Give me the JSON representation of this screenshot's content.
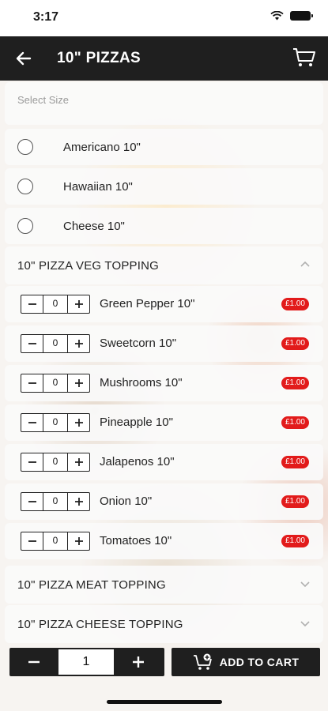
{
  "status_bar": {
    "time": "3:17"
  },
  "app_bar": {
    "title": "10\" PIZZAS"
  },
  "size_section": {
    "placeholder": "Select Size",
    "options": [
      {
        "label": "Americano 10\""
      },
      {
        "label": "Hawaiian 10\""
      },
      {
        "label": "Cheese 10\""
      }
    ]
  },
  "sections": {
    "veg_topping": {
      "title": "10\" PIZZA VEG TOPPING",
      "expanded": true,
      "items": [
        {
          "label": "Green Pepper 10\"",
          "qty": "0",
          "price": "£1.00"
        },
        {
          "label": "Sweetcorn 10\"",
          "qty": "0",
          "price": "£1.00"
        },
        {
          "label": "Mushrooms 10\"",
          "qty": "0",
          "price": "£1.00"
        },
        {
          "label": "Pineapple 10\"",
          "qty": "0",
          "price": "£1.00"
        },
        {
          "label": "Jalapenos 10\"",
          "qty": "0",
          "price": "£1.00"
        },
        {
          "label": "Onion 10\"",
          "qty": "0",
          "price": "£1.00"
        },
        {
          "label": "Tomatoes 10\"",
          "qty": "0",
          "price": "£1.00"
        }
      ]
    },
    "meat_topping": {
      "title": "10\" PIZZA MEAT TOPPING",
      "expanded": false
    },
    "cheese_topping": {
      "title": "10\" PIZZA CHEESE TOPPING",
      "expanded": false
    }
  },
  "bottom_bar": {
    "quantity": "1",
    "add_to_cart_label": "ADD TO CART"
  },
  "icons": {
    "back": "arrow-left-icon",
    "cart": "cart-icon",
    "expand": "chevron-up-icon",
    "collapse": "chevron-down-icon",
    "minus": "minus-icon",
    "plus": "plus-icon"
  },
  "colors": {
    "app_bar": "#1f1f1f",
    "price_badge": "#e21b1b"
  }
}
